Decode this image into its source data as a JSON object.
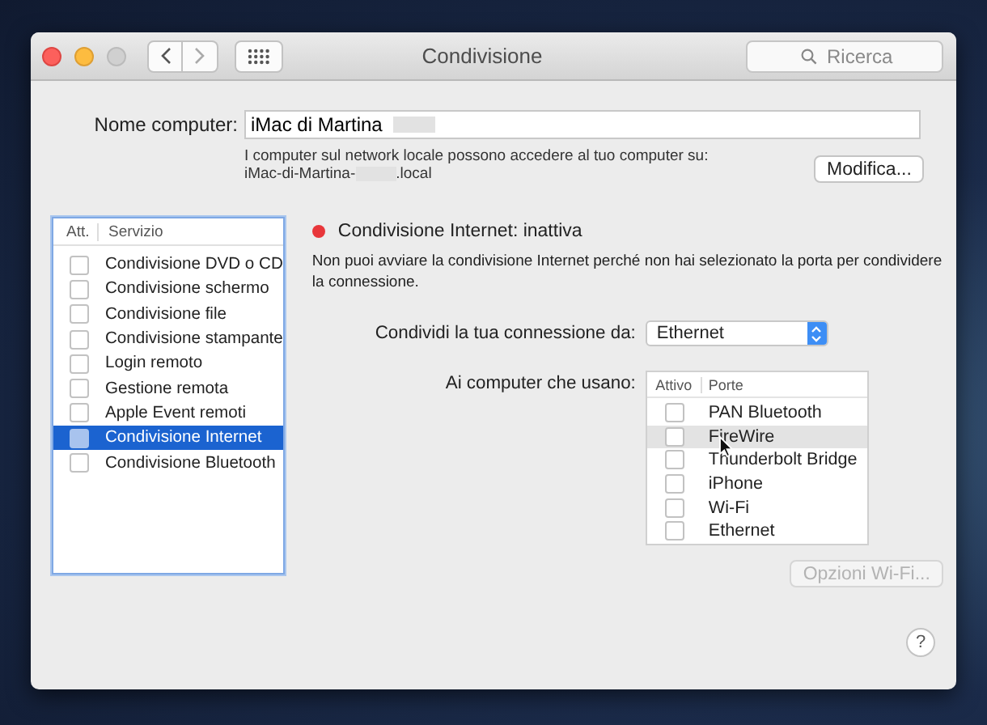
{
  "window": {
    "title": "Condivisione",
    "search": {
      "placeholder": "Ricerca"
    }
  },
  "computer_name": {
    "label": "Nome computer:",
    "value": "iMac di Martina",
    "hint": "I computer sul network locale possono accedere al tuo computer su:",
    "host_prefix": "iMac-di-Martina-",
    "host_suffix": ".local",
    "edit_button": "Modifica..."
  },
  "services": {
    "columns": [
      "Att.",
      "Servizio"
    ],
    "rows": [
      {
        "name": "Condivisione DVD o CD",
        "checked": false,
        "selected": false
      },
      {
        "name": "Condivisione schermo",
        "checked": false,
        "selected": false
      },
      {
        "name": "Condivisione file",
        "checked": false,
        "selected": false
      },
      {
        "name": "Condivisione stampante",
        "checked": false,
        "selected": false
      },
      {
        "name": "Login remoto",
        "checked": false,
        "selected": false
      },
      {
        "name": "Gestione remota",
        "checked": false,
        "selected": false
      },
      {
        "name": "Apple Event remoti",
        "checked": false,
        "selected": false
      },
      {
        "name": "Condivisione Internet",
        "checked": false,
        "selected": true
      },
      {
        "name": "Condivisione Bluetooth",
        "checked": false,
        "selected": false
      }
    ]
  },
  "detail": {
    "status": {
      "text": "Condivisione Internet: inattiva",
      "on": false
    },
    "description": "Non puoi avviare la condivisione Internet perché non hai selezionato la porta per condividere la connessione.",
    "share_from": {
      "label": "Condividi la tua connessione da:",
      "value": "Ethernet"
    },
    "ports": {
      "label": "Ai computer che usano:",
      "columns": [
        "Attivo",
        "Porte"
      ],
      "rows": [
        {
          "name": "PAN Bluetooth",
          "checked": false,
          "hovered": false
        },
        {
          "name": "FireWire",
          "checked": false,
          "hovered": true
        },
        {
          "name": "Thunderbolt Bridge",
          "checked": false,
          "hovered": false
        },
        {
          "name": "iPhone",
          "checked": false,
          "hovered": false
        },
        {
          "name": "Wi-Fi",
          "checked": false,
          "hovered": false
        },
        {
          "name": "Ethernet",
          "checked": false,
          "hovered": false
        }
      ]
    },
    "wifi_options_button": {
      "label": "Opzioni Wi-Fi...",
      "disabled": true
    }
  },
  "help_button": "?"
}
